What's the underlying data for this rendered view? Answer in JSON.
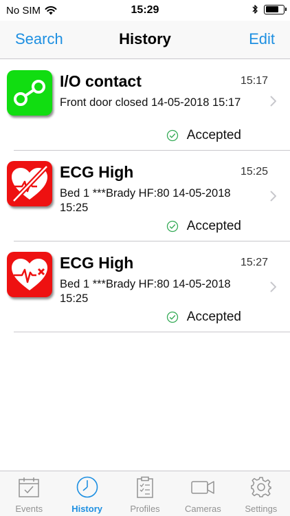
{
  "status_bar": {
    "carrier": "No SIM",
    "time": "15:29",
    "battery_level": 0.72
  },
  "nav": {
    "left": "Search",
    "title": "History",
    "right": "Edit"
  },
  "items": [
    {
      "icon": "io-contact-icon",
      "icon_color": "#11dd11",
      "title": "I/O contact",
      "time": "15:17",
      "line1": "Front door closed 14-05-2018 15:17",
      "line2": "",
      "status": "Accepted"
    },
    {
      "icon": "heart-crossed-icon",
      "icon_color": "#ee1111",
      "title": "ECG High",
      "time": "15:25",
      "line1": "Bed 1 ***Brady HF:80 14-05-2018",
      "line2": "15:25",
      "status": "Accepted"
    },
    {
      "icon": "heart-ecg-icon",
      "icon_color": "#ee1111",
      "title": "ECG High",
      "time": "15:27",
      "line1": "Bed 1 ***Brady HF:80 14-05-2018",
      "line2": "15:25",
      "status": "Accepted"
    }
  ],
  "tabs": [
    {
      "label": "Events",
      "icon": "calendar-check-icon",
      "active": false
    },
    {
      "label": "History",
      "icon": "clock-icon",
      "active": true
    },
    {
      "label": "Profiles",
      "icon": "clipboard-checklist-icon",
      "active": false
    },
    {
      "label": "Cameras",
      "icon": "video-camera-icon",
      "active": false
    },
    {
      "label": "Settings",
      "icon": "gear-icon",
      "active": false
    }
  ],
  "colors": {
    "accent": "#1d8fe1",
    "inactive_tab": "#929292",
    "accepted_check": "#33aa55"
  }
}
